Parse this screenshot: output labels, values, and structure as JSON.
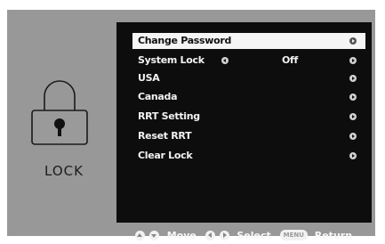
{
  "sidebar": {
    "label": "LOCK",
    "icon": "padlock-icon"
  },
  "menu": {
    "items": [
      {
        "label": "Change Password",
        "value": "",
        "selected": true
      },
      {
        "label": "System Lock",
        "value": "Off",
        "selected": false
      },
      {
        "label": "USA",
        "value": "",
        "selected": false
      },
      {
        "label": "Canada",
        "value": "",
        "selected": false
      },
      {
        "label": "RRT Setting",
        "value": "",
        "selected": false
      },
      {
        "label": "Reset RRT",
        "value": "",
        "selected": false
      },
      {
        "label": "Clear Lock",
        "value": "",
        "selected": false
      }
    ]
  },
  "footer": {
    "move_label": "Move",
    "select_label": "Select",
    "menu_key": "MENU",
    "return_label": "Return"
  },
  "colors": {
    "background": "#989898",
    "menu_bg": "#0d0d0d",
    "highlight": "#f5f5f5"
  }
}
